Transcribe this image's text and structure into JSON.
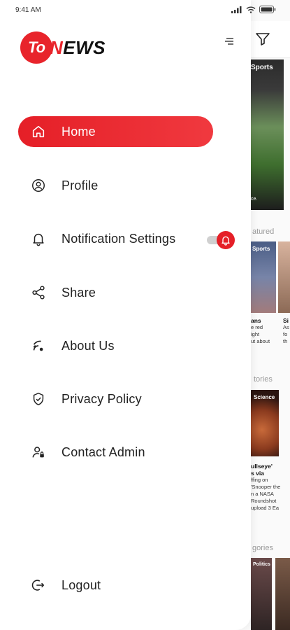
{
  "status_bar": {
    "time": "9:41 AM"
  },
  "drawer": {
    "logo": {
      "circle_text": "To",
      "news_first": "N",
      "news_rest": "EWS"
    },
    "menu": [
      {
        "id": "home",
        "label": "Home",
        "icon": "home-icon",
        "active": true
      },
      {
        "id": "profile",
        "label": "Profile",
        "icon": "user-circle-icon",
        "active": false
      },
      {
        "id": "notification-settings",
        "label": "Notification Settings",
        "icon": "bell-icon",
        "active": false
      },
      {
        "id": "share",
        "label": "Share",
        "icon": "share-icon",
        "active": false
      },
      {
        "id": "about-us",
        "label": "About Us",
        "icon": "about-icon",
        "active": false
      },
      {
        "id": "privacy-policy",
        "label": "Privacy Policy",
        "icon": "shield-check-icon",
        "active": false
      },
      {
        "id": "contact-admin",
        "label": "Contact Admin",
        "icon": "contact-admin-icon",
        "active": false
      }
    ],
    "notification_toggle": {
      "on": true,
      "icon": "bell-icon"
    },
    "logout": {
      "label": "Logout",
      "icon": "logout-icon"
    }
  },
  "background": {
    "top_story": {
      "tag": "Sports",
      "caption": "ce."
    },
    "sections": {
      "featured": "atured",
      "stories": "tories",
      "categories": "gories"
    },
    "featured_card": {
      "tag": "Sports",
      "title": "ans",
      "lines": [
        "e red",
        "ight",
        "ut about"
      ],
      "title2": "Si",
      "lines2": [
        "As",
        "fo",
        "th"
      ]
    },
    "science_card": {
      "tag": "Science",
      "title": "ullseye'",
      "title2": "s via",
      "lines": [
        "ffing on",
        "'Snooper the",
        "n a NASA",
        "Roundshot",
        "upload 3 Ea"
      ]
    },
    "politics_tag": "Politics"
  },
  "colors": {
    "accent": "#e51f27",
    "text": "#222222"
  }
}
